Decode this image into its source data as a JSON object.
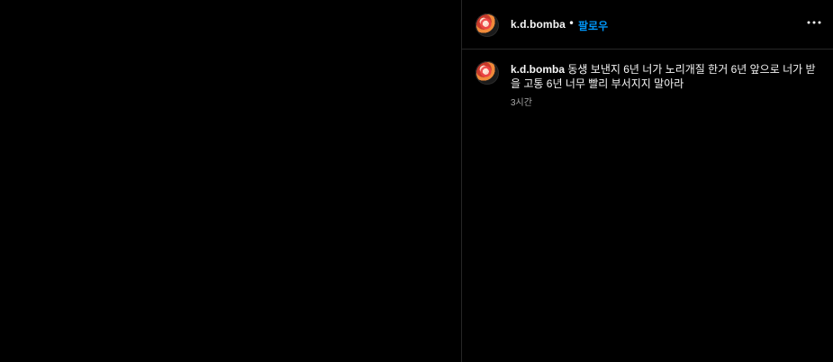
{
  "post": {
    "header": {
      "username": "k.d.bomba",
      "separator": "•",
      "follow_label": "팔로우",
      "more_icon": "more-horizontal-icon"
    },
    "caption": {
      "username": "k.d.bomba",
      "text": "동생 보낸지 6년 너가 노리개질 한거 6년 앞으로 너가 받을 고통 6년 너무 빨리 부서지지 말아라",
      "time": "3시간"
    }
  },
  "colors": {
    "background": "#000000",
    "text": "#f5f5f5",
    "accent": "#0095f6",
    "muted": "#a8a8a8",
    "divider": "#262626"
  }
}
